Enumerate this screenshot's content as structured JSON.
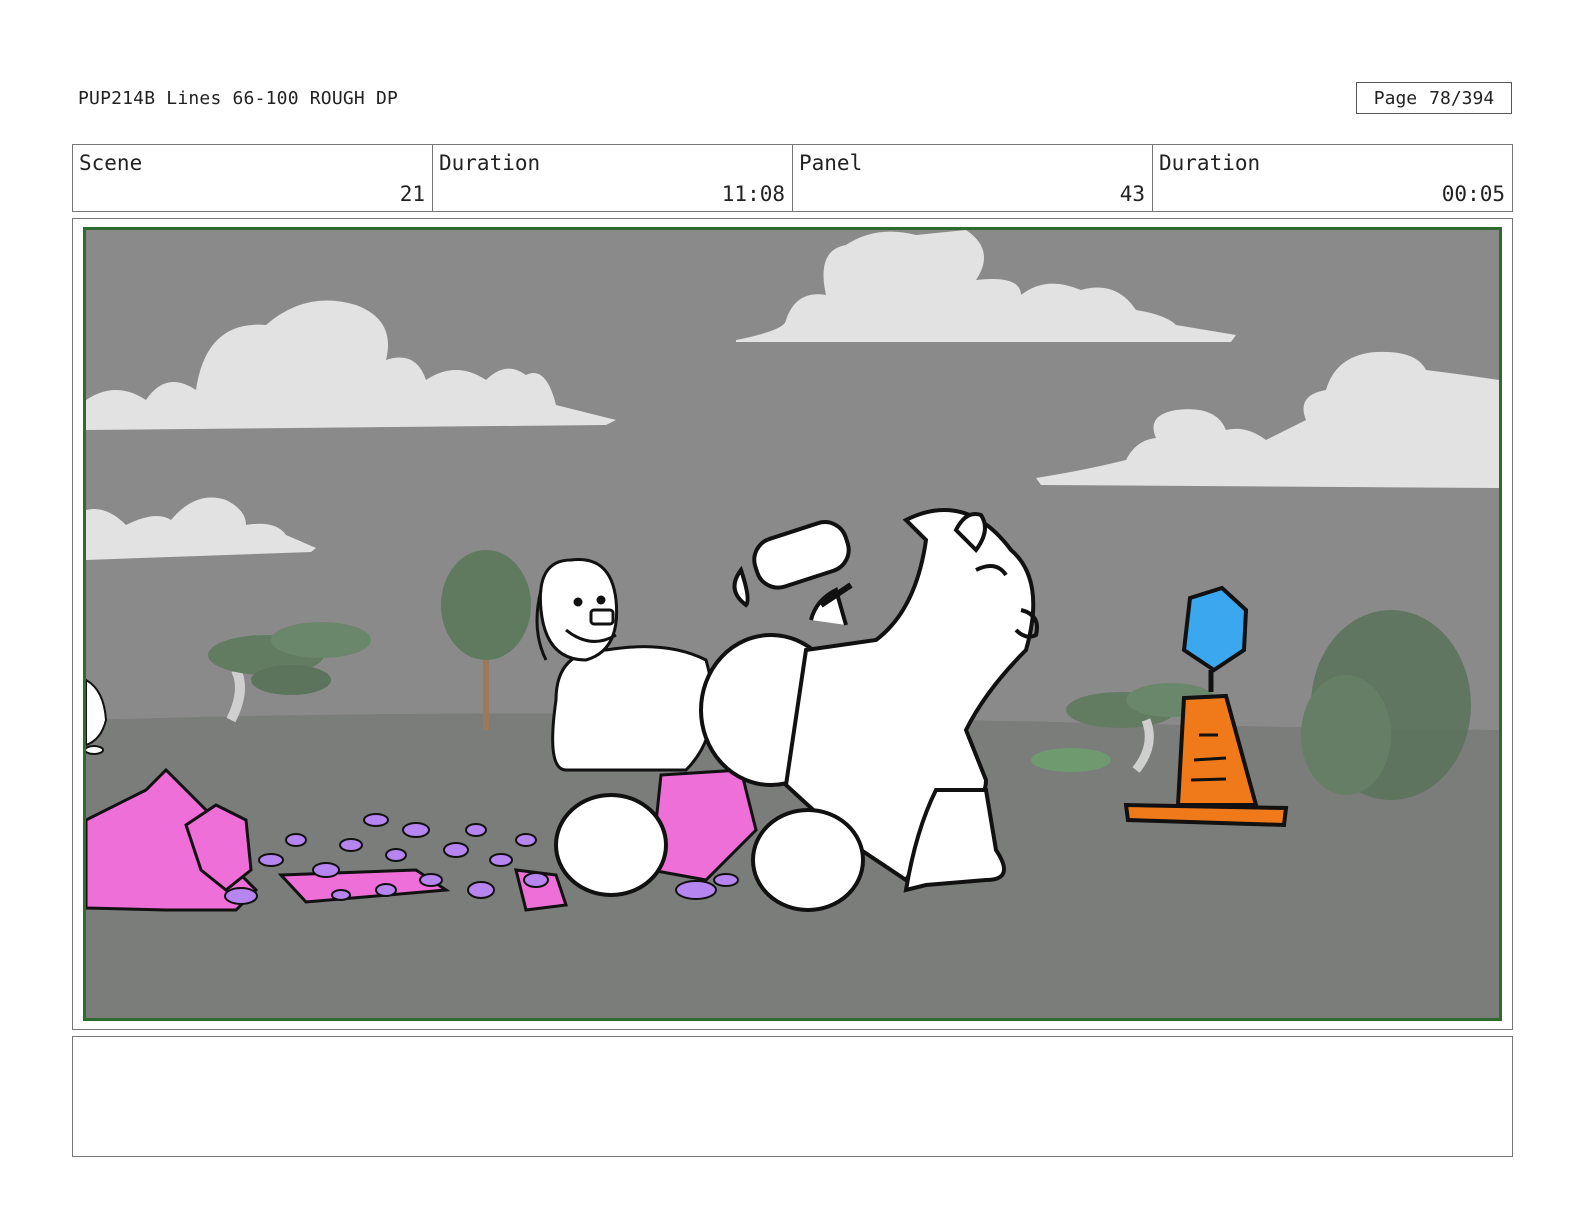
{
  "header": {
    "doc_title": "PUP214B Lines 66-100 ROUGH DP",
    "page_label": "Page",
    "page_value": "78/394"
  },
  "info": {
    "scene_label": "Scene",
    "scene_value": "21",
    "scene_duration_label": "Duration",
    "scene_duration_value": "11:08",
    "panel_label": "Panel",
    "panel_value": "43",
    "panel_duration_label": "Duration",
    "panel_duration_value": "00:05"
  },
  "colors": {
    "frame_border": "#2f6a2f",
    "sky": "#8a8a8a",
    "ground": "#7a7d79",
    "cloud": "#e2e2e2",
    "rocks": "#ee6fd8",
    "pebbles": "#b785f0",
    "hexagon": "#3aa7ee",
    "cone": "#f07a1a",
    "trees": "#627c62"
  },
  "notes": {
    "text": ""
  }
}
